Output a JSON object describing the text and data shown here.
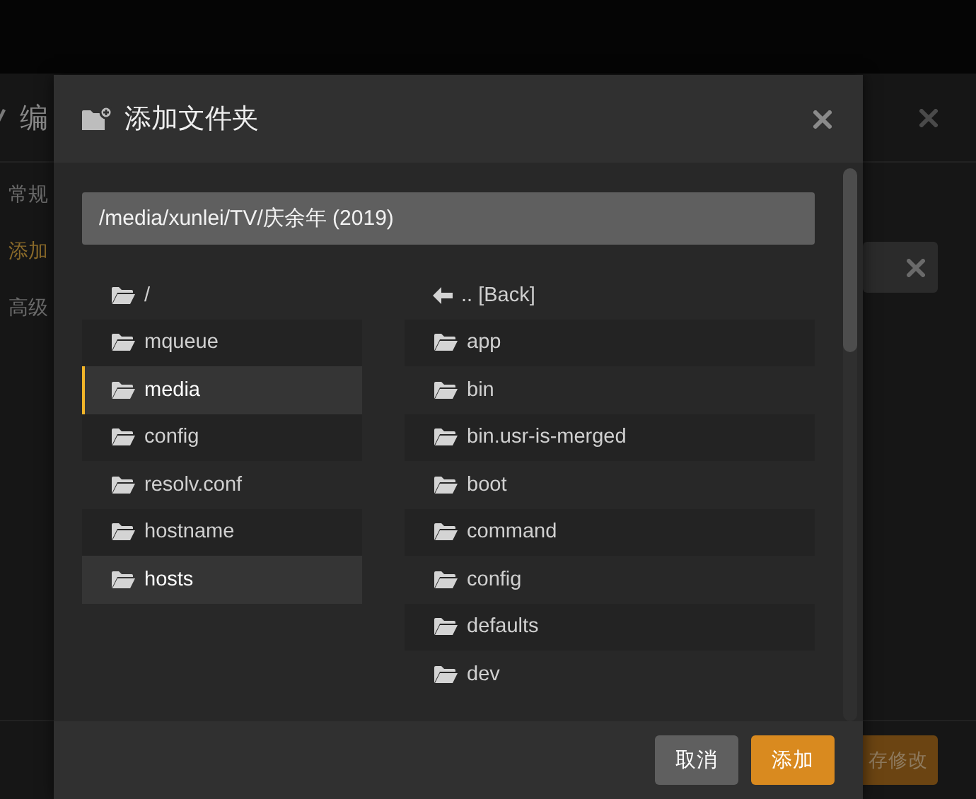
{
  "background": {
    "title": "编",
    "sidebar": [
      {
        "label": "常规",
        "selected": false
      },
      {
        "label": "添加",
        "selected": true
      },
      {
        "label": "高级",
        "selected": false
      }
    ],
    "save_button": "存修改"
  },
  "dialog": {
    "title": "添加文件夹",
    "path": "/media/xunlei/TV/庆余年 (2019)",
    "left_list": [
      {
        "kind": "folder",
        "label": "/",
        "selected": false,
        "hovered": false
      },
      {
        "kind": "folder",
        "label": "mqueue",
        "selected": false,
        "hovered": false
      },
      {
        "kind": "folder",
        "label": "media",
        "selected": true,
        "hovered": false
      },
      {
        "kind": "folder",
        "label": "config",
        "selected": false,
        "hovered": false
      },
      {
        "kind": "folder",
        "label": "resolv.conf",
        "selected": false,
        "hovered": false
      },
      {
        "kind": "folder",
        "label": "hostname",
        "selected": false,
        "hovered": false
      },
      {
        "kind": "folder",
        "label": "hosts",
        "selected": false,
        "hovered": true
      }
    ],
    "right_list": [
      {
        "kind": "back",
        "label": ".. [Back]",
        "selected": false,
        "hovered": false
      },
      {
        "kind": "folder",
        "label": "app",
        "selected": false,
        "hovered": false
      },
      {
        "kind": "folder",
        "label": "bin",
        "selected": false,
        "hovered": false
      },
      {
        "kind": "folder",
        "label": "bin.usr-is-merged",
        "selected": false,
        "hovered": false
      },
      {
        "kind": "folder",
        "label": "boot",
        "selected": false,
        "hovered": false
      },
      {
        "kind": "folder",
        "label": "command",
        "selected": false,
        "hovered": false
      },
      {
        "kind": "folder",
        "label": "config",
        "selected": false,
        "hovered": false
      },
      {
        "kind": "folder",
        "label": "defaults",
        "selected": false,
        "hovered": false
      },
      {
        "kind": "folder",
        "label": "dev",
        "selected": false,
        "hovered": false
      }
    ],
    "buttons": [
      {
        "label": "取消",
        "kind": "secondary"
      },
      {
        "label": "添加",
        "kind": "primary"
      }
    ]
  }
}
